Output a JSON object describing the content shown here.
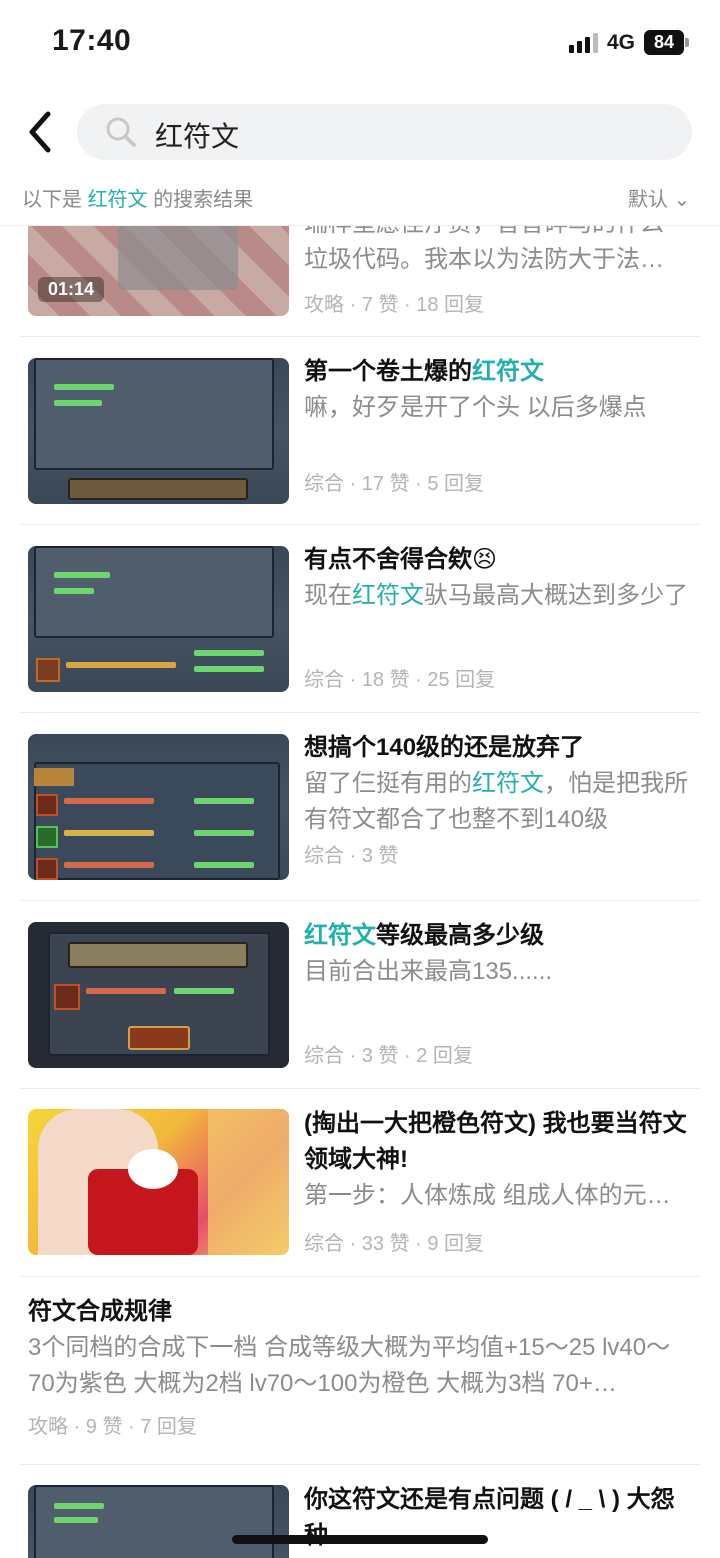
{
  "status_bar": {
    "time": "17:40",
    "network": "4G",
    "battery": "84"
  },
  "search": {
    "query": "红符文"
  },
  "result_header": {
    "prefix": "以下是 ",
    "keyword": "红符文",
    "suffix": " 的搜索结果",
    "sort_label": "默认 ⌄"
  },
  "posts": [
    {
      "excerpt_line1": "瑞样堂愿佳疗贾，音音碎马的什么",
      "excerpt_line2": "垃圾代码。我本以为法防大于法…",
      "meta": "攻略 · 7 赞 · 18 回复",
      "video_duration": "01:14"
    },
    {
      "title_before": "第一个卷土爆的",
      "title_highlight": "红符文",
      "excerpt": "嘛，好歹是开了个头 以后多爆点",
      "meta": "综合 · 17 赞 · 5 回复"
    },
    {
      "title": "有点不舍得合欸😣",
      "excerpt_before": "现在",
      "excerpt_highlight": "红符文",
      "excerpt_after": "驮马最高大概达到多少了",
      "meta": "综合 · 18 赞 · 25 回复"
    },
    {
      "title": "想搞个140级的还是放弃了",
      "excerpt_before": "留了仨挺有用的",
      "excerpt_highlight": "红符文",
      "excerpt_after": "，怕是把我所有符文都合了也整不到140级",
      "meta": "综合 · 3 赞"
    },
    {
      "title_highlight": "红符文",
      "title_after": "等级最高多少级",
      "excerpt": "目前合出来最高135......",
      "meta": "综合 · 3 赞 · 2 回复"
    },
    {
      "title": "(掏出一大把橙色符文) 我也要当符文领域大神!",
      "excerpt": "第一步：人体炼成 组成人体的元…",
      "meta": "综合 · 33 赞 · 9 回复"
    },
    {
      "title": "符文合成规律",
      "excerpt": "3个同档的合成下一档 合成等级大概为平均值+15～25 lv40～70为紫色 大概为2档 lv70～100为橙色 大概为3档 70+…",
      "meta": "攻略 · 9 赞 · 7 回复"
    },
    {
      "title": "你这符文还是有点问题 ( / _ \\ ) 大怨种"
    }
  ],
  "colors": {
    "highlight": "#20b2aa",
    "meta": "#b4b4b4",
    "excerpt": "#8c8c8c"
  }
}
